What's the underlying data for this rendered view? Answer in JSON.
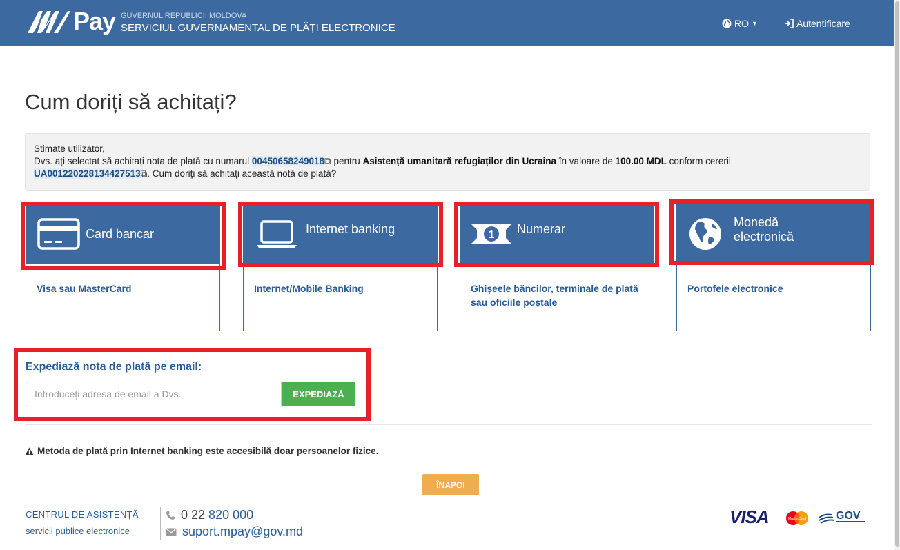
{
  "header": {
    "logo_text": "Pay",
    "gov_small": "GUVERNUL REPUBLICII MOLDOVA",
    "gov_big": "SERVICIUL GUVERNAMENTAL DE PLĂȚI ELECTRONICE",
    "lang": "RO",
    "login": "Autentificare"
  },
  "page": {
    "title": "Cum doriți să achitați?"
  },
  "info": {
    "greeting": "Stimate utilizator,",
    "t1": "Dvs. ați selectat să achitați nota de plată cu numarul ",
    "invoice": "00450658249018",
    "t2": " pentru ",
    "service": "Asistență umanitară refugiaților din Ucraina",
    "t3": " în valoare de ",
    "amount": "100.00 MDL",
    "t4": " conform cererii",
    "request": "UA001220228134427513",
    "t5": ". Cum doriți să achitați această notă de plată?"
  },
  "methods": [
    {
      "title": "Card bancar",
      "desc": "Visa sau MasterCard"
    },
    {
      "title": "Internet banking",
      "desc": "Internet/Mobile Banking"
    },
    {
      "title": "Numerar",
      "desc": "Ghișeele băncilor, terminale de plată sau oficiile poștale"
    },
    {
      "title": "Monedă electronică",
      "desc": "Portofele electronice"
    }
  ],
  "email": {
    "title": "Expediază nota de plată pe email:",
    "placeholder": "Introduceți adresa de email a Dvs.",
    "button": "EXPEDIAZĂ"
  },
  "warning": "Metoda de plată prin Internet banking este accesibilă doar persoanelor fizice.",
  "back_button": "ÎNAPOI",
  "footer": {
    "help_title": "CENTRUL DE ASISTENȚĂ",
    "help_sub": "servicii publice electronice",
    "phone_prefix": "0 22 ",
    "phone_number": "820 000",
    "email": "suport.mpay@gov.md",
    "visa": "VISA",
    "mastercard": "MasterCard",
    "gov": "GOV"
  },
  "colors": {
    "header_bg": "#3c6aa0",
    "highlight_red": "#e8202a",
    "send_green": "#4caf50",
    "back_orange": "#f0ad4e"
  }
}
